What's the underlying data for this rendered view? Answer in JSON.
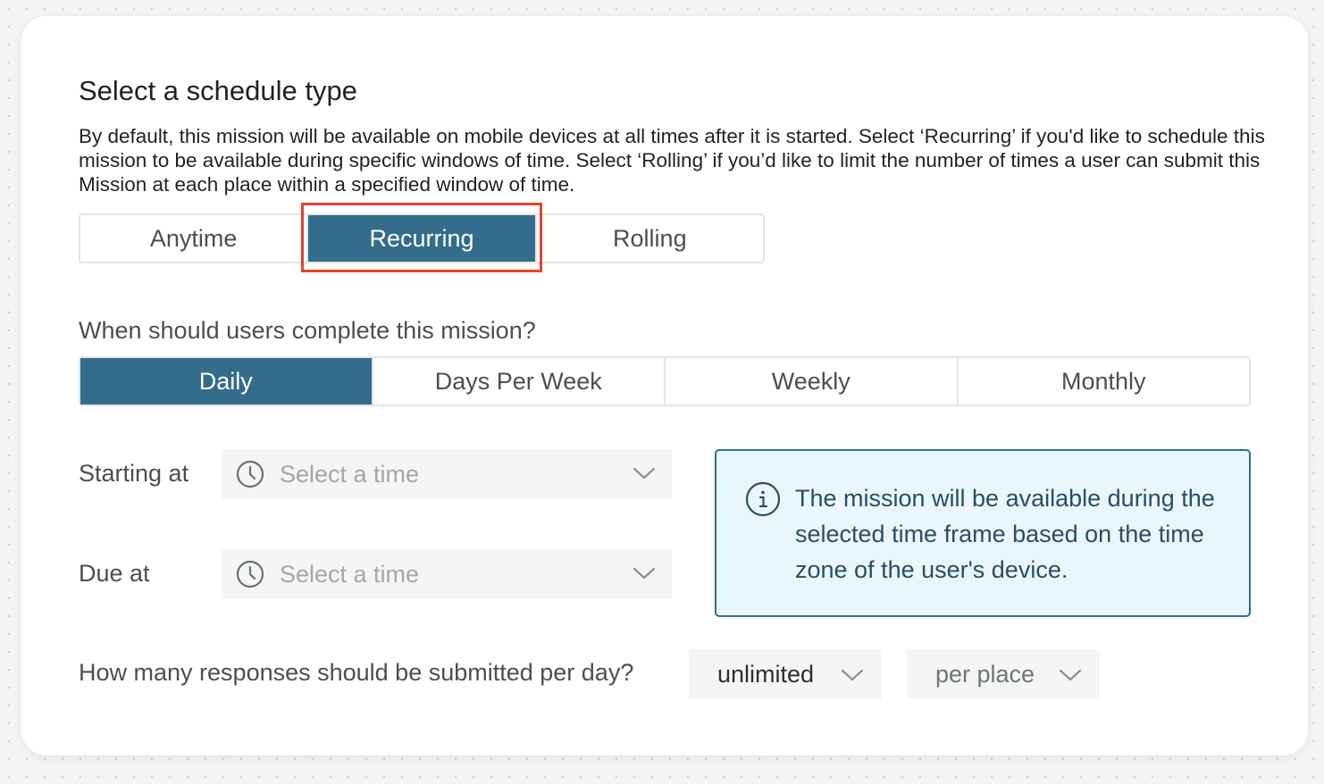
{
  "schedule": {
    "title": "Select a schedule type",
    "description": "By default, this mission will be available on mobile devices at all times after it is started. Select ‘Recurring’ if you'd like to schedule this mission to be available during specific windows of time. Select ‘Rolling’ if you’d like to limit the number of times a user can submit this Mission at each place within a specified window of time.",
    "options": [
      {
        "label": "Anytime",
        "selected": false
      },
      {
        "label": "Recurring",
        "selected": true
      },
      {
        "label": "Rolling",
        "selected": false
      }
    ]
  },
  "frequency": {
    "question": "When should users complete this mission?",
    "options": [
      {
        "label": "Daily",
        "selected": true
      },
      {
        "label": "Days Per Week",
        "selected": false
      },
      {
        "label": "Weekly",
        "selected": false
      },
      {
        "label": "Monthly",
        "selected": false
      }
    ]
  },
  "times": {
    "starting_label": "Starting at",
    "starting_placeholder": "Select a time",
    "due_label": "Due at",
    "due_placeholder": "Select a time"
  },
  "info": {
    "text": "The mission will be available during the selected time frame based on the time zone of the user's device."
  },
  "responses": {
    "question": "How many responses should be submitted per day?",
    "count_value": "unlimited",
    "scope_value": "per place"
  },
  "colors": {
    "primary": "#336d8b",
    "highlight": "#e2452e",
    "info_bg": "#e9f6fb"
  },
  "icons": {
    "time": "clock-icon",
    "dropdown": "chevron-down-icon",
    "info": "info-icon"
  }
}
